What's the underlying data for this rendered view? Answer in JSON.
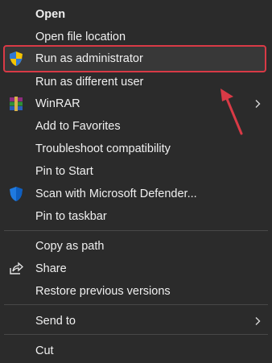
{
  "menu": {
    "items": [
      {
        "label": "Open",
        "icon": null,
        "bold": true
      },
      {
        "label": "Open file location",
        "icon": null
      },
      {
        "label": "Run as administrator",
        "icon": "uac-shield-icon",
        "highlighted": true
      },
      {
        "label": "Run as different user",
        "icon": null
      },
      {
        "label": "WinRAR",
        "icon": "winrar-icon",
        "submenu": true
      },
      {
        "label": "Add to Favorites",
        "icon": null
      },
      {
        "label": "Troubleshoot compatibility",
        "icon": null
      },
      {
        "label": "Pin to Start",
        "icon": null
      },
      {
        "label": "Scan with Microsoft Defender...",
        "icon": "defender-shield-icon"
      },
      {
        "label": "Pin to taskbar",
        "icon": null
      },
      {
        "label": "Copy as path",
        "icon": null
      },
      {
        "label": "Share",
        "icon": "share-icon"
      },
      {
        "label": "Restore previous versions",
        "icon": null
      },
      {
        "label": "Send to",
        "icon": null,
        "submenu": true
      },
      {
        "label": "Cut",
        "icon": null
      }
    ]
  },
  "colors": {
    "background": "#2b2b2b",
    "highlight_border": "#d93a46",
    "annotation_arrow": "#d93a46",
    "text": "#f0f0f0"
  }
}
